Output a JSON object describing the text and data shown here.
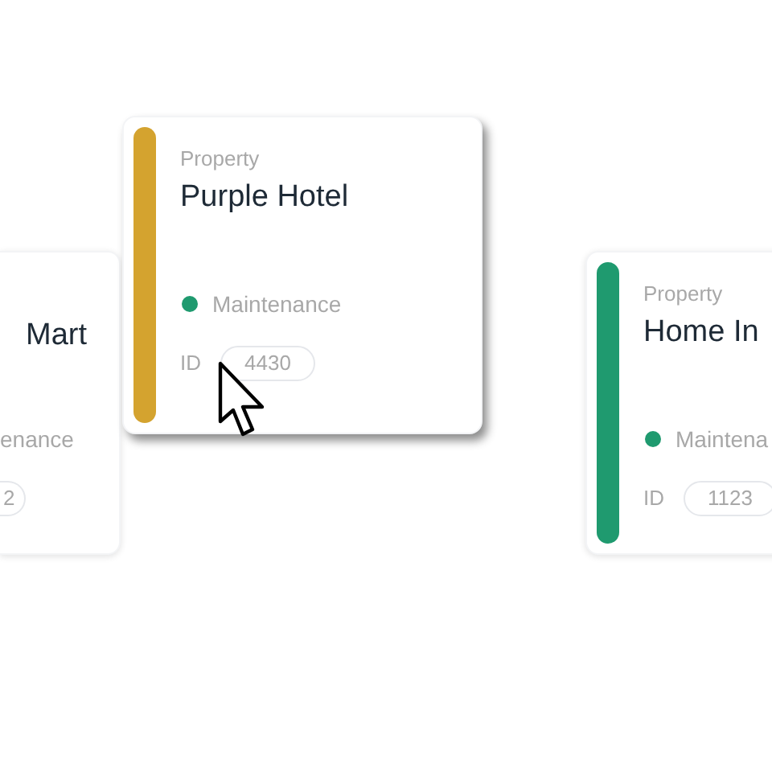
{
  "cards": [
    {
      "kind": "partial",
      "name": "Mart",
      "status": {
        "text": "enance"
      },
      "id": "2",
      "hovered": false
    },
    {
      "kind": "full",
      "label": "Property",
      "name": "Purple Hotel",
      "status": {
        "text": "Maintenance",
        "color": "#1f9a6f"
      },
      "id_label": "ID",
      "id": "4430",
      "color": "#d4a32f",
      "hovered": true
    },
    {
      "kind": "full",
      "label": "Property",
      "name": "Home In",
      "status": {
        "text": "Maintena",
        "color": "#1f9a6f"
      },
      "id_label": "ID",
      "id": "1123",
      "color": "#1f9a6f",
      "hovered": false
    }
  ]
}
